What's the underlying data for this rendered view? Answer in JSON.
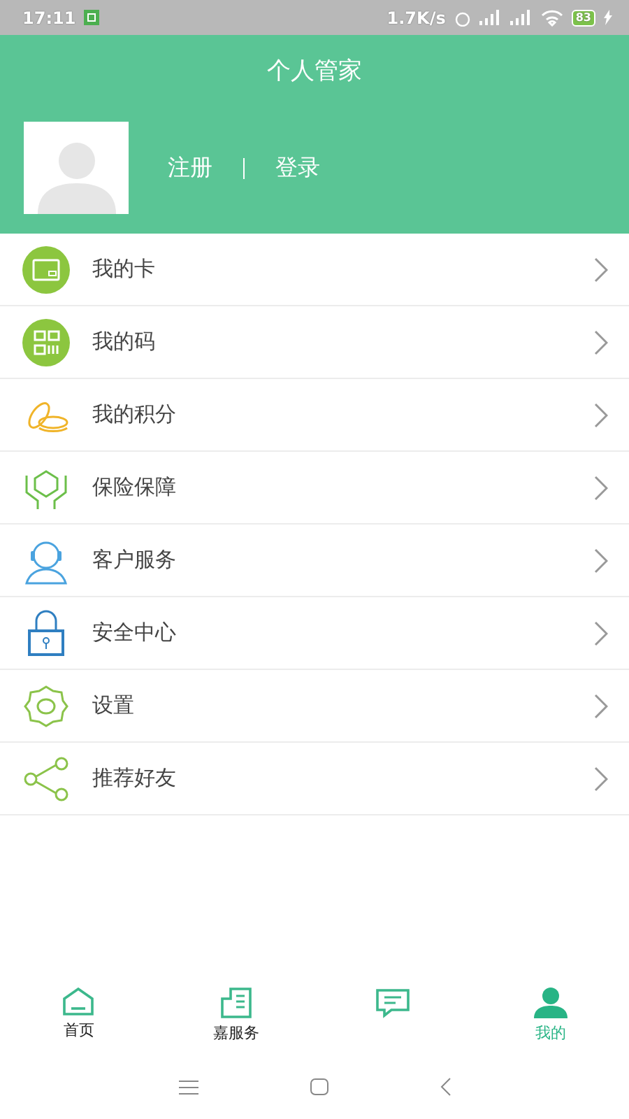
{
  "status_bar": {
    "time": "17:11",
    "speed": "1.7K/s",
    "battery": "83"
  },
  "header": {
    "title": "个人管家",
    "register": "注册",
    "login": "登录"
  },
  "menu": [
    {
      "label": "我的卡",
      "kind": "card"
    },
    {
      "label": "我的码",
      "kind": "code"
    },
    {
      "label": "我的积分",
      "kind": "coins"
    },
    {
      "label": "保险保障",
      "kind": "insurance"
    },
    {
      "label": "客户服务",
      "kind": "service"
    },
    {
      "label": "安全中心",
      "kind": "lock"
    },
    {
      "label": "设置",
      "kind": "gear"
    },
    {
      "label": "推荐好友",
      "kind": "share"
    }
  ],
  "tabs": [
    {
      "label": "首页",
      "kind": "home",
      "selected": false
    },
    {
      "label": "嘉服务",
      "kind": "service",
      "selected": false
    },
    {
      "kind": "message",
      "selected": false
    },
    {
      "label": "我的",
      "kind": "me",
      "selected": true
    }
  ]
}
